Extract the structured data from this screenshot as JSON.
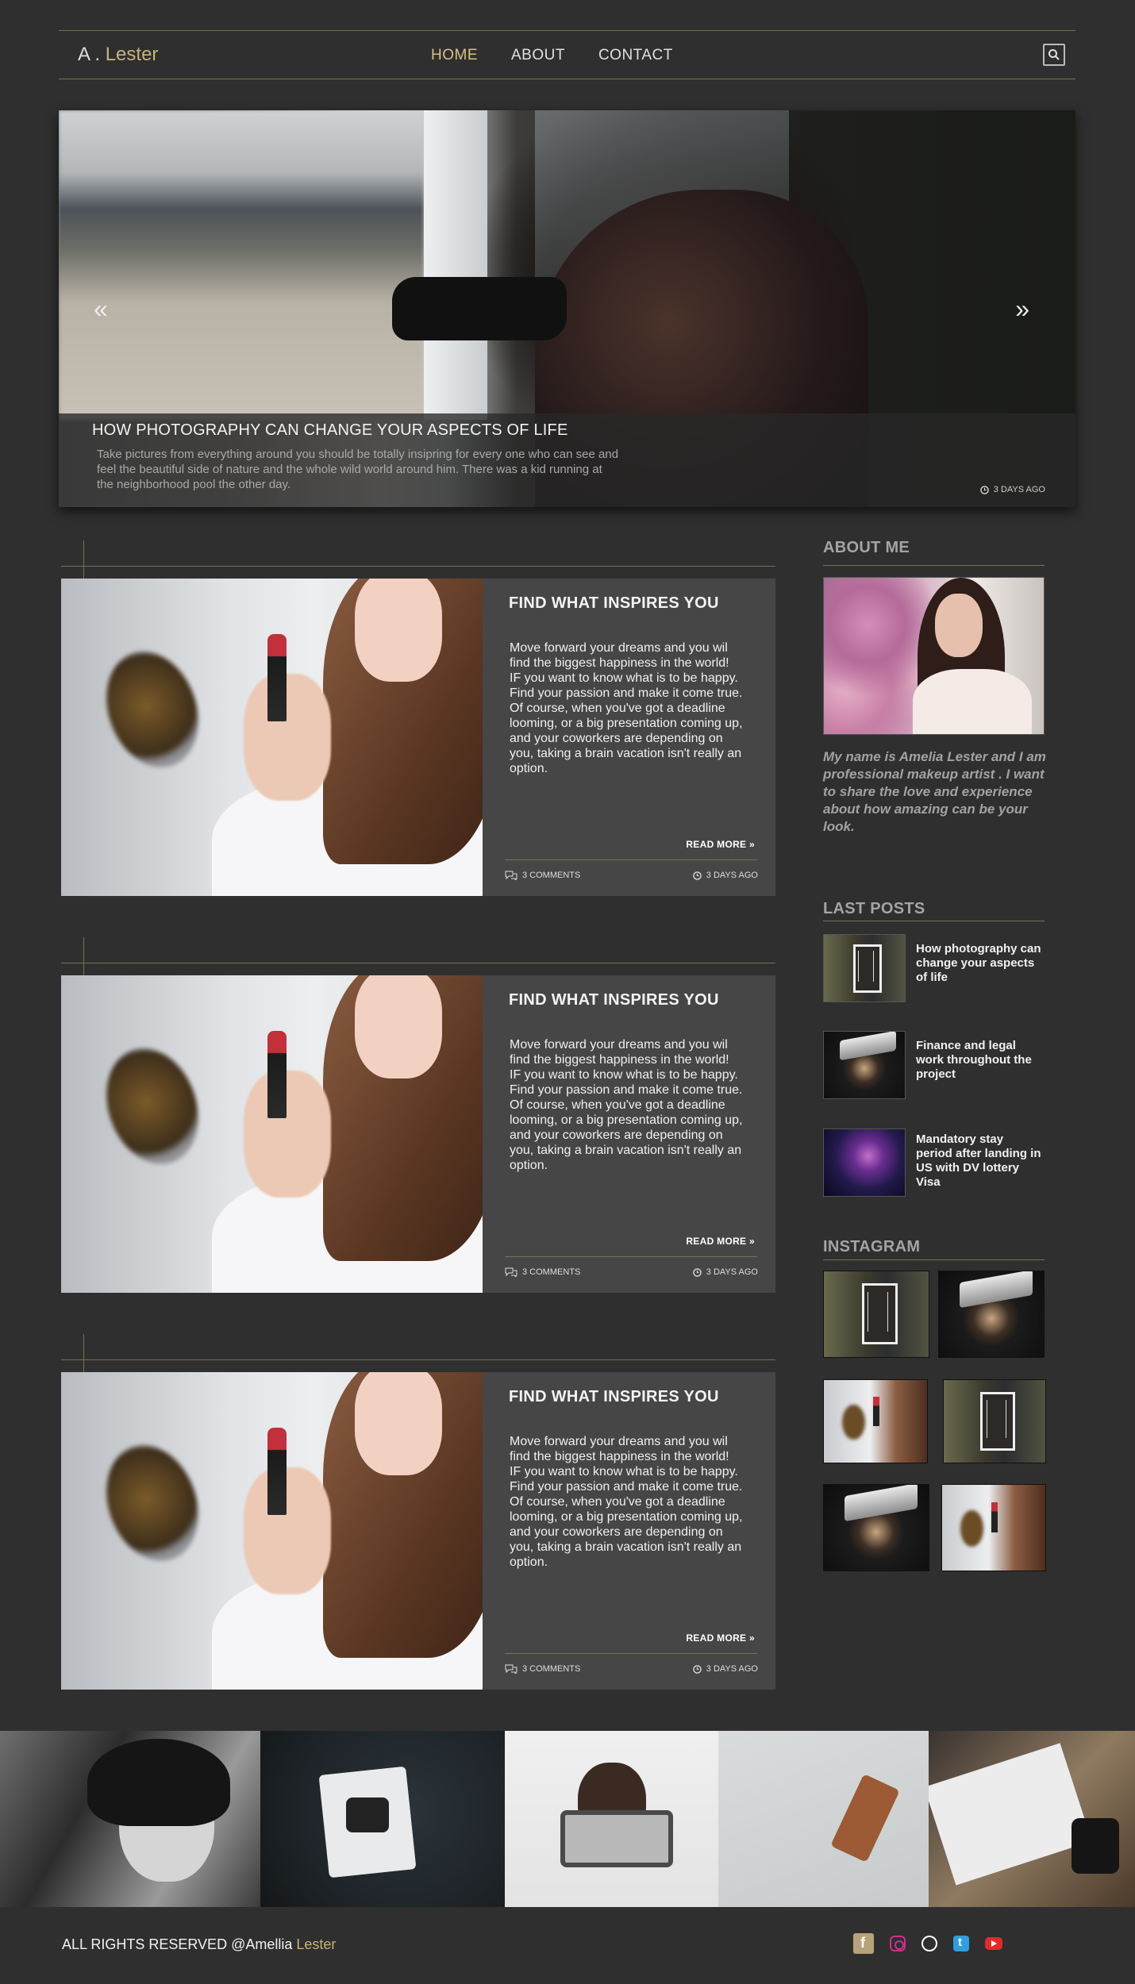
{
  "nav": {
    "logo_initial": "A .",
    "logo_name": "Lester",
    "items": [
      {
        "label": "HOME",
        "active": true
      },
      {
        "label": "ABOUT",
        "active": false
      },
      {
        "label": "CONTACT",
        "active": false
      }
    ],
    "search_icon": "search-icon"
  },
  "hero": {
    "prev_icon": "«",
    "next_icon": "»",
    "title": "HOW PHOTOGRAPHY CAN CHANGE YOUR ASPECTS OF  LIFE",
    "text": "Take pictures from everything around you should be totally insipring for every one who can see and feel the beautiful side of nature and the whole wild world around him. There was a kid running at the neighborhood  pool the other day.",
    "date": "3 DAYS AGO"
  },
  "posts": [
    {
      "title": "FIND WHAT  INSPIRES YOU",
      "body": "Move forward  your dreams and you wil find the biggest happiness in the world!\nIF you want to know what is to be happy. Find your passion and make it come true.\nOf course, when you've got a deadline looming, or a big presentation coming up, and your coworkers are depending on you, taking a brain vacation isn't really an option.",
      "read_more": "READ MORE",
      "comments": "3 COMMENTS",
      "date": "3 DAYS AGO"
    },
    {
      "title": "FIND WHAT  INSPIRES YOU",
      "body": "Move forward  your dreams and you wil find the biggest happiness in the world!\nIF you want to know what is to be happy. Find your passion and make it come true.\nOf course, when you've got a deadline looming, or a big presentation coming up, and your coworkers are depending on you, taking a brain vacation isn't really an option.",
      "read_more": "READ MORE",
      "comments": "3 COMMENTS",
      "date": "3 DAYS AGO"
    },
    {
      "title": "FIND WHAT  INSPIRES YOU",
      "body": "Move forward  your dreams and you wil find the biggest happiness in the world!\nIF you want to know what is to be happy. Find your passion and make it come true.\nOf course, when you've got a deadline looming, or a big presentation coming up, and your coworkers are depending on you, taking a brain vacation isn't really an option.",
      "read_more": "READ MORE",
      "comments": "3 COMMENTS",
      "date": "3 DAYS AGO"
    }
  ],
  "sidebar": {
    "about_title": "ABOUT ME",
    "about_text": "My name is Amelia Lester and I am professional makeup artist . I want to share the love and experience about how amazing can be your look.",
    "last_posts_title": "LAST POSTS",
    "last_posts": [
      {
        "title": "How photography can change your aspects of life"
      },
      {
        "title": "Finance and legal work throughout the project"
      },
      {
        "title": "Mandatory stay period after landing in US with DV lottery Visa"
      }
    ],
    "instagram_title": "INSTAGRAM"
  },
  "footer": {
    "copyright_prefix": "ALL RIGHTS RESERVED @Amellia",
    "copyright_name": "Lester",
    "socials": [
      "facebook-icon",
      "instagram-icon",
      "dribbble-icon",
      "twitter-icon",
      "youtube-icon"
    ]
  },
  "colors": {
    "background": "#2f2f2f",
    "accent": "#c8b27a",
    "card": "#464646",
    "divider": "#7d6f4c"
  }
}
